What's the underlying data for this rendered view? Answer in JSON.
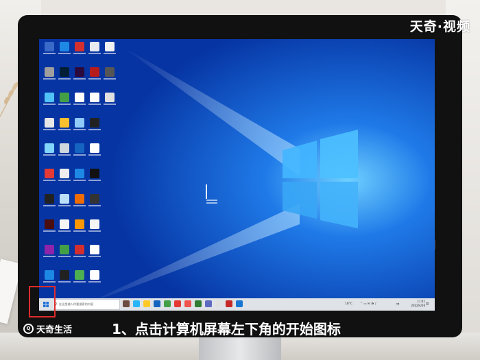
{
  "watermark": {
    "brand": "天奇·视频",
    "logo_text": "天奇生活",
    "logo_mark": "Q"
  },
  "caption": "1、点击计算机屏幕左下角的开始图标",
  "desktop": {
    "icon_colors": [
      [
        "#3b6ac9",
        "#1e88e5",
        "#d32f2f",
        "#e8eaf0",
        "#f2f2f2"
      ],
      [
        "#9e9e9e",
        "#001e36",
        "#2b0a3d",
        "#b71c1c",
        "#555555"
      ],
      [
        "#4fc3f7",
        "#43a047",
        "#ffffff",
        "#ffffff",
        "#e0e0e0"
      ],
      [
        "#e6e6e6",
        "#fbc02d",
        "#90caf9",
        "#222222",
        ""
      ],
      [
        "#81d4fa",
        "#cfd8dc",
        "#1565c0",
        "#ffffff",
        ""
      ],
      [
        "#e53935",
        "#eeeeee",
        "#1e88e5",
        "#111111",
        ""
      ],
      [
        "#212121",
        "#bbdefb",
        "#ef6c00",
        "#333333",
        ""
      ],
      [
        "#4a0e0e",
        "#f5f5f5",
        "#ff9800",
        "#f5f5f5",
        ""
      ],
      [
        "#8e24aa",
        "#43a047",
        "#d32f2f",
        "#ffffff",
        ""
      ],
      [
        "#1e88e5",
        "#212121",
        "#4caf50",
        "#ffffff",
        ""
      ]
    ]
  },
  "taskbar": {
    "search_placeholder": "在这里输入你要搜索的内容",
    "start_icon": "windows-logo-icon",
    "search_icon": "magnifier-icon",
    "app_colors": [
      "#6d4c41",
      "#29b6f6",
      "#ffca28",
      "#1565c0",
      "#43a047",
      "#e53935",
      "#ef5350",
      "#2e7d32",
      "#5c6bc0",
      "#e0e0e0",
      "#c62828",
      "#1976d2"
    ],
    "weather": "18°C",
    "tray_lang": "中",
    "time": "11:41",
    "date": "2022/4/26"
  },
  "colors": {
    "highlight": "#e02b2b",
    "wallpaper": "#0a3fb5",
    "taskbar": "#dfe3e8"
  }
}
